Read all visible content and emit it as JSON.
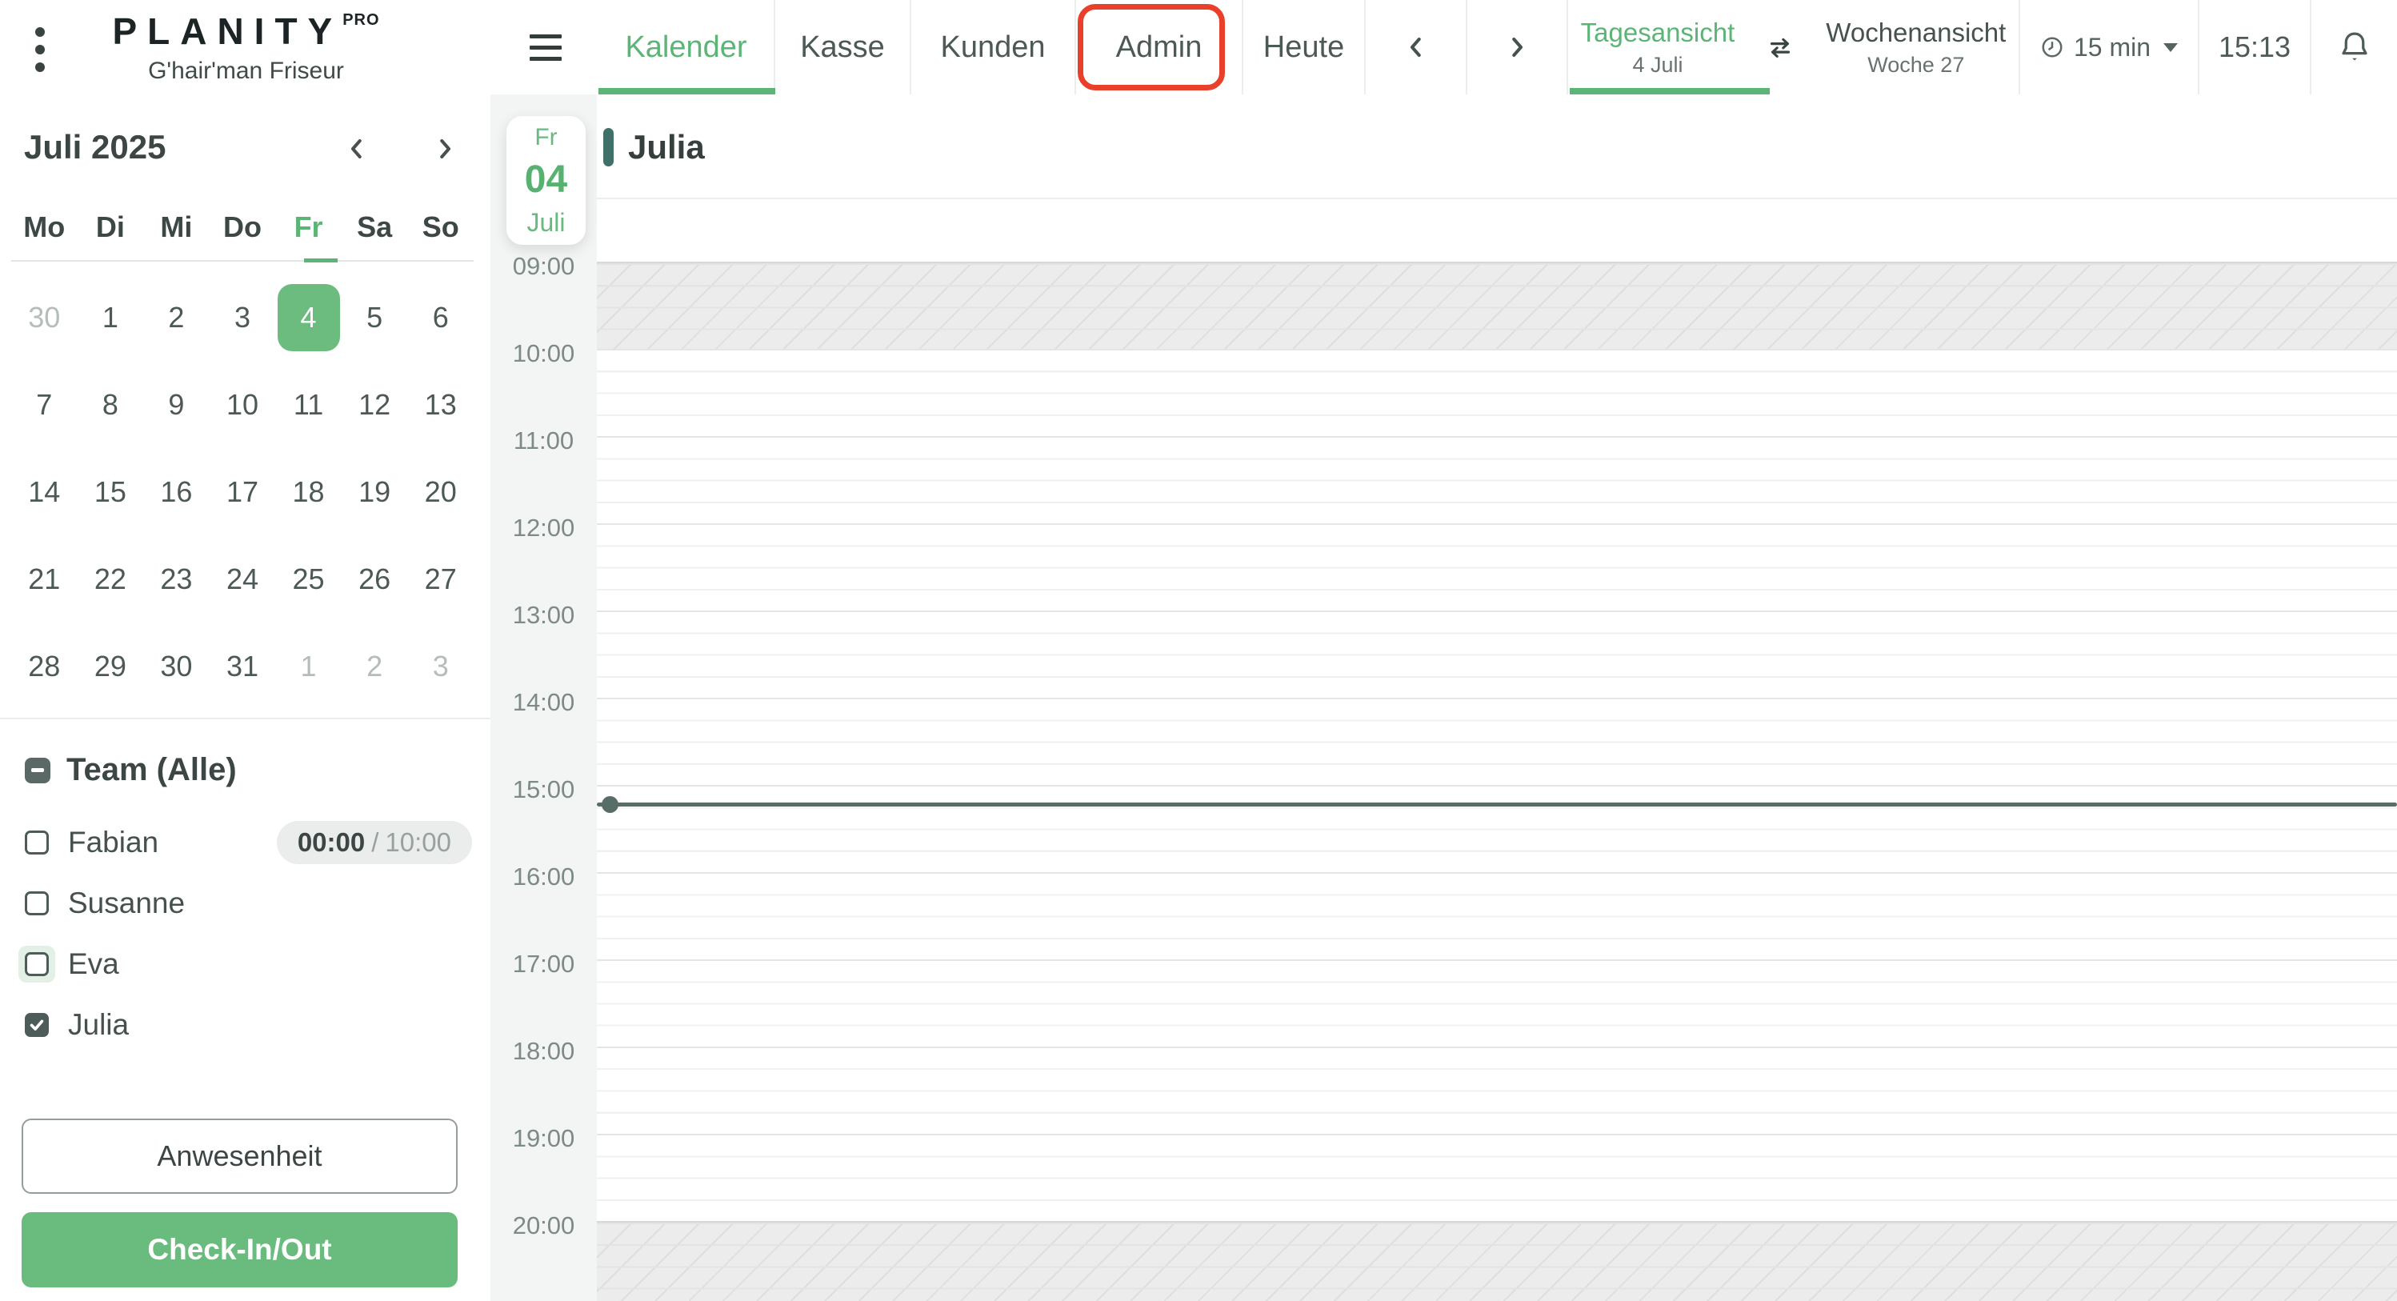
{
  "topbar": {
    "brand": {
      "name": "PLANITY",
      "badge": "PRO",
      "subtitle": "G'hair'man Friseur"
    },
    "tabs": {
      "kalender": "Kalender",
      "kasse": "Kasse",
      "kunden": "Kunden",
      "admin": "Admin",
      "heute": "Heute"
    },
    "views": {
      "day_label": "Tagesansicht",
      "day_sub": "4 Juli",
      "week_label": "Wochenansicht",
      "week_sub": "Woche 27"
    },
    "interval_label": "15 min",
    "time": "15:13"
  },
  "mini_calendar": {
    "title": "Juli 2025",
    "weekdays": [
      "Mo",
      "Di",
      "Mi",
      "Do",
      "Fr",
      "Sa",
      "So"
    ],
    "weeks": [
      [
        "30",
        "1",
        "2",
        "3",
        "4",
        "5",
        "6"
      ],
      [
        "7",
        "8",
        "9",
        "10",
        "11",
        "12",
        "13"
      ],
      [
        "14",
        "15",
        "16",
        "17",
        "18",
        "19",
        "20"
      ],
      [
        "21",
        "22",
        "23",
        "24",
        "25",
        "26",
        "27"
      ],
      [
        "28",
        "29",
        "30",
        "31",
        "1",
        "2",
        "3"
      ]
    ],
    "selected_day": "4"
  },
  "team": {
    "title": "Team (Alle)",
    "members": [
      {
        "name": "Fabian",
        "worked": "00:00",
        "sep": "/",
        "total": "10:00",
        "checked": false
      },
      {
        "name": "Susanne",
        "checked": false
      },
      {
        "name": "Eva",
        "checked": false
      },
      {
        "name": "Julia",
        "checked": true
      }
    ]
  },
  "actions": {
    "attendance": "Anwesenheit",
    "checkin": "Check-In/Out"
  },
  "schedule": {
    "date_chip": {
      "weekday": "Fr",
      "day": "04",
      "month": "Juli"
    },
    "column_title": "Julia",
    "times": [
      "09:00",
      "10:00",
      "11:00",
      "12:00",
      "13:00",
      "14:00",
      "15:00",
      "16:00",
      "17:00",
      "18:00",
      "19:00",
      "20:00"
    ],
    "current_time": "15:13"
  },
  "colors": {
    "accent_green": "#5cb577",
    "selected_day_green": "#6cbc80",
    "button_green": "#6abc7e",
    "column_bar_teal": "#3f7168",
    "now_line": "#596d68",
    "annotation_red": "#e8402b",
    "dark_text": "#3b4645"
  }
}
